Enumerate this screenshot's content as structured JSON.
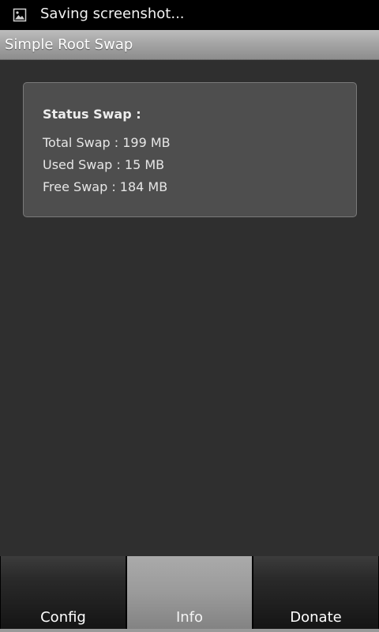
{
  "status_bar": {
    "icon": "image-icon",
    "text": "Saving screenshot..."
  },
  "app": {
    "title": "Simple Root Swap"
  },
  "status_card": {
    "heading": "Status Swap :",
    "lines": [
      {
        "label": "Total Swap :",
        "value": "199 MB",
        "text": "Total Swap :  199 MB"
      },
      {
        "label": "Used Swap :",
        "value": "15 MB",
        "text": "Used Swap :  15 MB"
      },
      {
        "label": "Free Swap :",
        "value": "184 MB",
        "text": "Free Swap :  184 MB"
      }
    ]
  },
  "tabs": [
    {
      "label": "Config",
      "selected": false
    },
    {
      "label": "Info",
      "selected": true
    },
    {
      "label": "Donate",
      "selected": false
    }
  ],
  "colors": {
    "background": "#2f2f2f",
    "card": "#4e4e4e",
    "active_tab": "#9a9a9a",
    "status_bar": "#000000"
  }
}
